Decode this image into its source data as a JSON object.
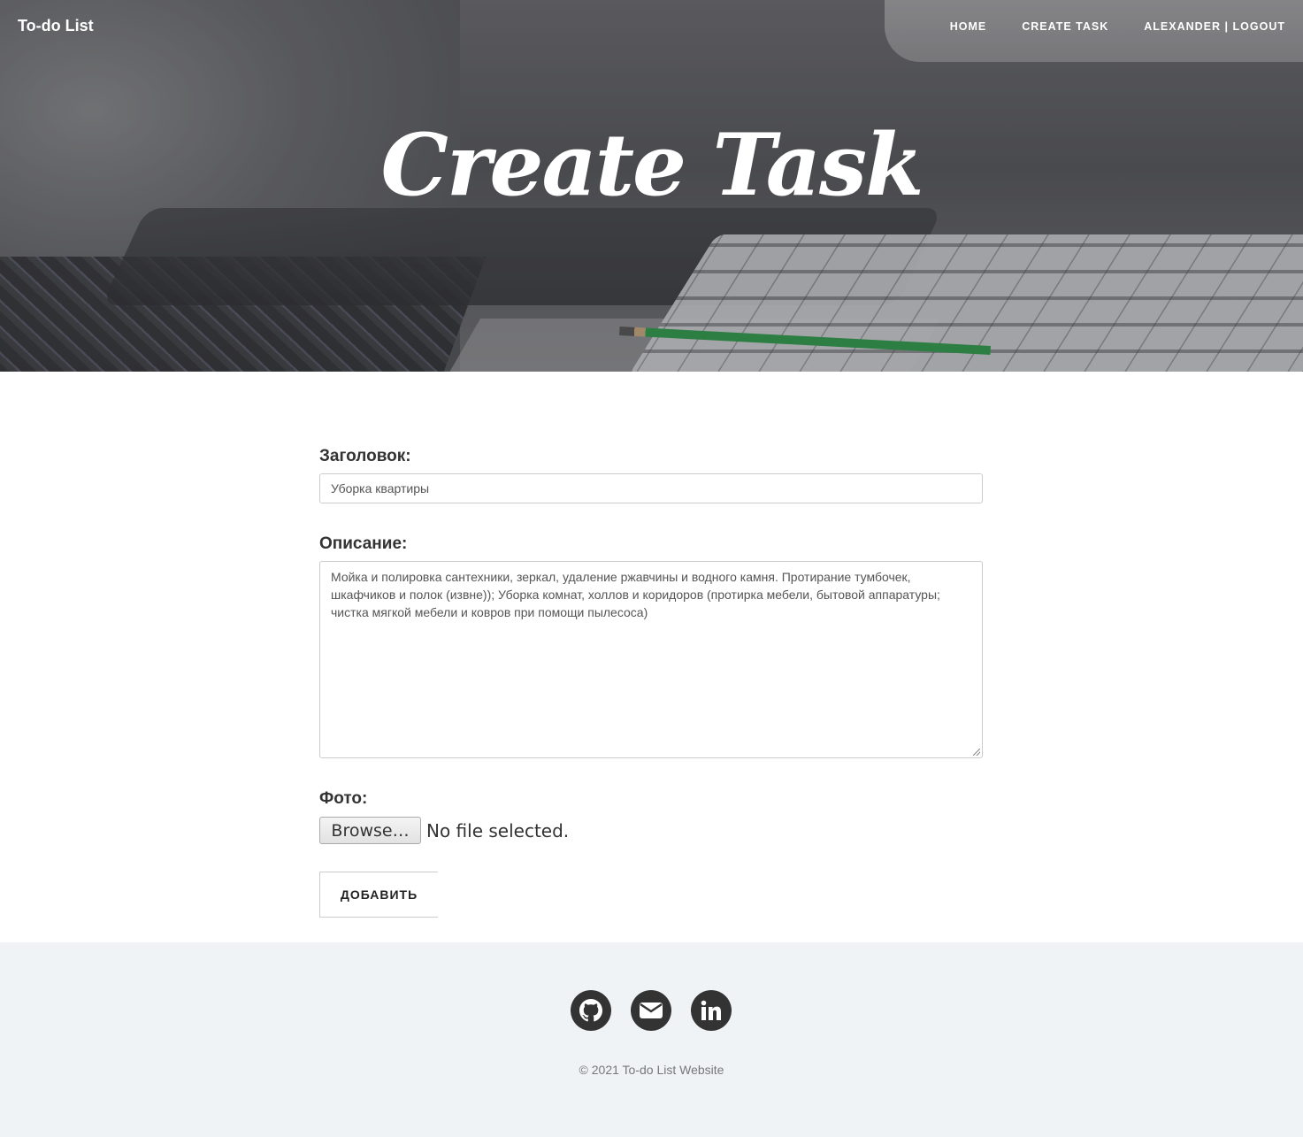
{
  "nav": {
    "brand": "To-do List",
    "home": "HOME",
    "create_task": "CREATE TASK",
    "user": "ALEXANDER",
    "separator": "|",
    "logout": "LOGOUT"
  },
  "hero": {
    "title": "Create Task"
  },
  "form": {
    "title_label": "Заголовок:",
    "title_value": "Уборка квартиры",
    "description_label": "Описание:",
    "description_value": "Мойка и полировка сантехники, зеркал, удаление ржавчины и водного камня. Протирание тумбочек, шкафчиков и полок (извне)); Уборка комнат, холлов и коридоров (протирка мебели, бытовой аппаратуры; чистка мягкой мебели и ковров при помощи пылесоса)",
    "photo_label": "Фото:",
    "browse_label": "Browse…",
    "no_file": "No file selected.",
    "submit_label": "ДОБАВИТЬ"
  },
  "footer": {
    "icons": [
      "github-icon",
      "envelope-icon",
      "linkedin-icon"
    ],
    "copyright": "© 2021 To-do List Website"
  }
}
